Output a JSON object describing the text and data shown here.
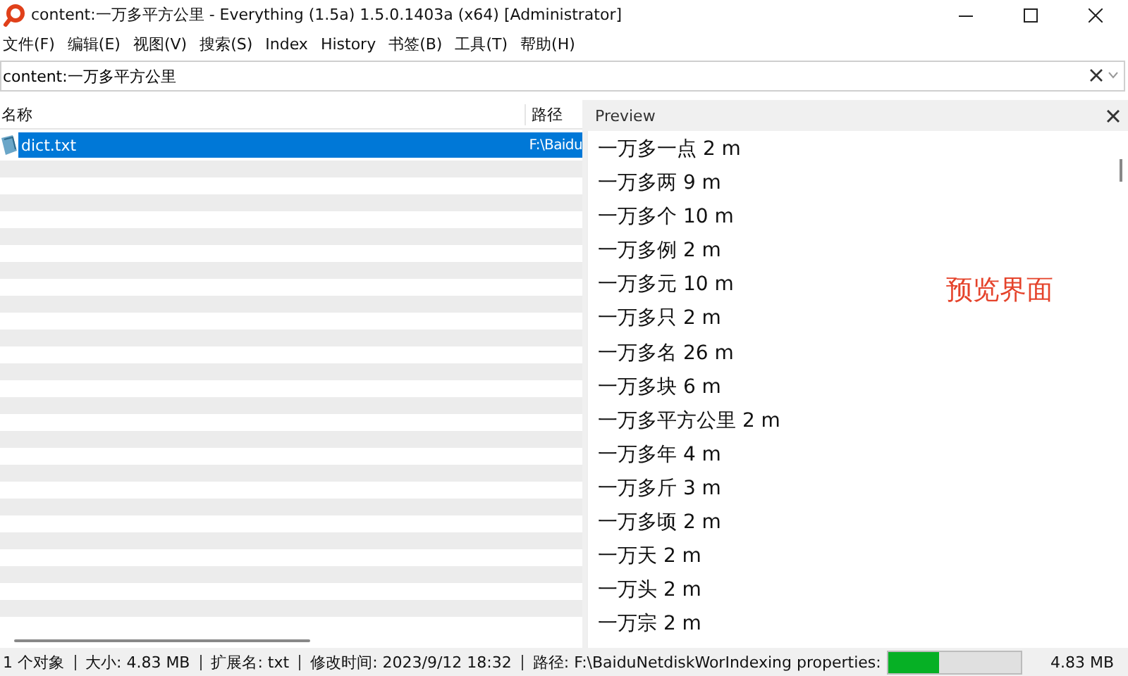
{
  "window": {
    "title": "content:一万多平方公里 - Everything (1.5a) 1.5.0.1403a (x64) [Administrator]"
  },
  "menu": [
    "文件(F)",
    "编辑(E)",
    "视图(V)",
    "搜索(S)",
    "Index",
    "History",
    "书签(B)",
    "工具(T)",
    "帮助(H)"
  ],
  "search": {
    "value": "content:一万多平方公里"
  },
  "results": {
    "columns": [
      "名称",
      "路径"
    ],
    "rows": [
      {
        "name": "dict.txt",
        "path": "F:\\Baidu",
        "selected": true
      }
    ]
  },
  "preview": {
    "title": "Preview",
    "lines": [
      "一万多一点 2 m",
      "一万多两 9 m",
      "一万多个 10 m",
      "一万多例 2 m",
      "一万多元 10 m",
      "一万多只 2 m",
      "一万多名 26 m",
      "一万多块 6 m",
      "一万多平方公里 2 m",
      "一万多年 4 m",
      "一万多斤 3 m",
      "一万多顷 2 m",
      "一万天 2 m",
      "一万头 2 m",
      "一万宗 2 m"
    ],
    "annotation": "预览界面"
  },
  "status_bar": {
    "items": [
      "1 个对象",
      "大小: 4.83 MB",
      "扩展名: txt",
      "修改时间: 2023/9/12 18:32",
      "路径: F:\\BaiduNetdiskWor"
    ],
    "progress_label": "Indexing properties:",
    "progress": {
      "level": 0.38
    },
    "size": "4.83 MB"
  }
}
